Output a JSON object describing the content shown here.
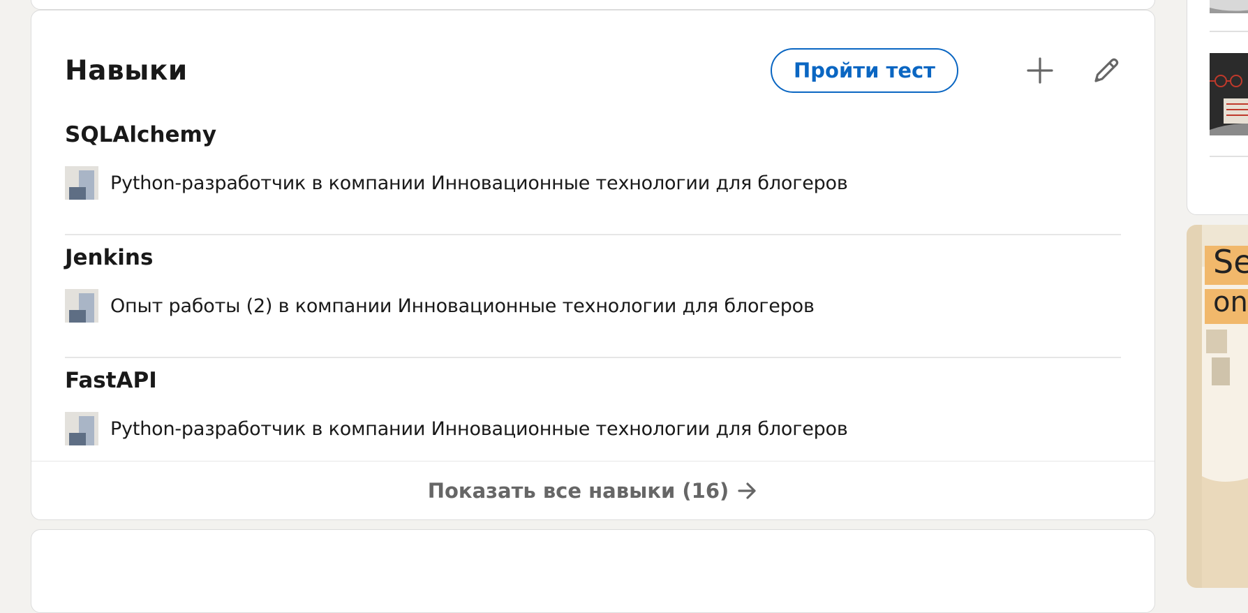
{
  "skills_section": {
    "title": "Навыки",
    "take_test_label": "Пройти тест",
    "add_icon": "plus-icon",
    "edit_icon": "pencil-icon",
    "skills": [
      {
        "name": "SQLAlchemy",
        "context": "Python-разработчик в компании Инновационные технологии для блогеров"
      },
      {
        "name": "Jenkins",
        "context": "Опыт работы (2) в компании Инновационные технологии для блогеров"
      },
      {
        "name": "FastAPI",
        "context": "Python-разработчик в компании Инновационные технологии для блогеров"
      }
    ],
    "show_all_label": "Показать все навыки (16)"
  },
  "right_rail": {
    "ad_text_line1": "Se",
    "ad_text_line2": "on"
  },
  "colors": {
    "accent": "#0a66c2",
    "text": "#191919",
    "muted": "#666666",
    "page_bg": "#f3f2ef",
    "card_bg": "#ffffff",
    "divider": "#e6e6e6"
  }
}
